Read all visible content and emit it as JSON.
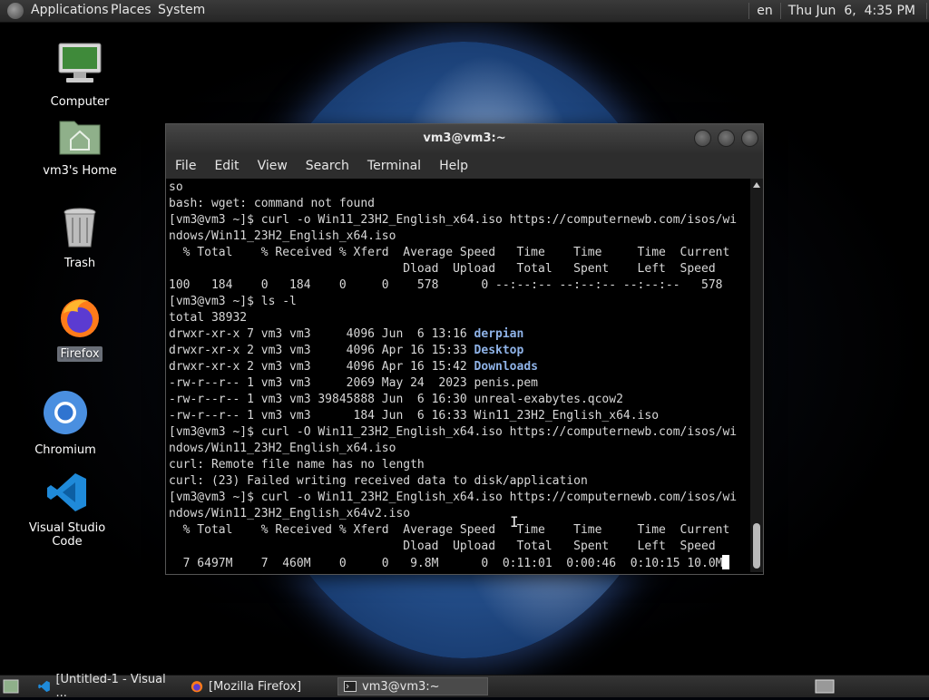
{
  "top_panel": {
    "menus": [
      "Applications",
      "Places",
      "System"
    ],
    "keyboard_layout": "en",
    "clock": "Thu Jun  6,  4:35 PM"
  },
  "desktop": {
    "icons": [
      {
        "label": "Computer",
        "icon": "computer-icon"
      },
      {
        "label": "vm3's Home",
        "icon": "home-folder-icon"
      },
      {
        "label": "Trash",
        "icon": "trash-icon"
      },
      {
        "label": "Firefox",
        "icon": "firefox-icon",
        "selected": true
      },
      {
        "label": "Chromium",
        "icon": "chromium-icon"
      },
      {
        "label": "Visual Studio Code",
        "icon": "vscode-icon"
      }
    ]
  },
  "terminal": {
    "title": "vm3@vm3:~",
    "menu": [
      "File",
      "Edit",
      "View",
      "Search",
      "Terminal",
      "Help"
    ],
    "lines": [
      "so",
      "bash: wget: command not found",
      "[vm3@vm3 ~]$ curl -o Win11_23H2_English_x64.iso https://computernewb.com/isos/wi",
      "ndows/Win11_23H2_English_x64.iso",
      "  % Total    % Received % Xferd  Average Speed   Time    Time     Time  Current",
      "                                 Dload  Upload   Total   Spent    Left  Speed",
      "100   184    0   184    0     0    578      0 --:--:-- --:--:-- --:--:--   578",
      "[vm3@vm3 ~]$ ls -l",
      "total 38932"
    ],
    "listing": [
      {
        "perms": "drwxr-xr-x 7 vm3 vm3     4096 Jun  6 13:16 ",
        "name": "derpian",
        "dir": true
      },
      {
        "perms": "drwxr-xr-x 2 vm3 vm3     4096 Apr 16 15:33 ",
        "name": "Desktop",
        "dir": true
      },
      {
        "perms": "drwxr-xr-x 2 vm3 vm3     4096 Apr 16 15:42 ",
        "name": "Downloads",
        "dir": true
      },
      {
        "perms": "-rw-r--r-- 1 vm3 vm3     2069 May 24  2023 ",
        "name": "penis.pem",
        "dir": false
      },
      {
        "perms": "-rw-r--r-- 1 vm3 vm3 39845888 Jun  6 16:30 ",
        "name": "unreal-exabytes.qcow2",
        "dir": false
      },
      {
        "perms": "-rw-r--r-- 1 vm3 vm3      184 Jun  6 16:33 ",
        "name": "Win11_23H2_English_x64.iso",
        "dir": false
      }
    ],
    "lines_after": [
      "[vm3@vm3 ~]$ curl -O Win11_23H2_English_x64.iso https://computernewb.com/isos/wi",
      "ndows/Win11_23H2_English_x64.iso",
      "curl: Remote file name has no length",
      "curl: (23) Failed writing received data to disk/application",
      "[vm3@vm3 ~]$ curl -o Win11_23H2_English_x64.iso https://computernewb.com/isos/wi",
      "ndows/Win11_23H2_English_x64v2.iso",
      "  % Total    % Received % Xferd  Average Speed   Time    Time     Time  Current",
      "                                 Dload  Upload   Total   Spent    Left  Speed",
      "  7 6497M    7  460M    0     0   9.8M      0  0:11:01  0:00:46  0:10:15 10.0M"
    ]
  },
  "taskbar": {
    "tasks": [
      {
        "label": "[Untitled-1 - Visual ...",
        "icon": "vscode-icon",
        "active": false
      },
      {
        "label": "[Mozilla Firefox]",
        "icon": "firefox-icon",
        "active": false
      },
      {
        "label": "vm3@vm3:~",
        "icon": "terminal-icon",
        "active": true
      }
    ]
  }
}
